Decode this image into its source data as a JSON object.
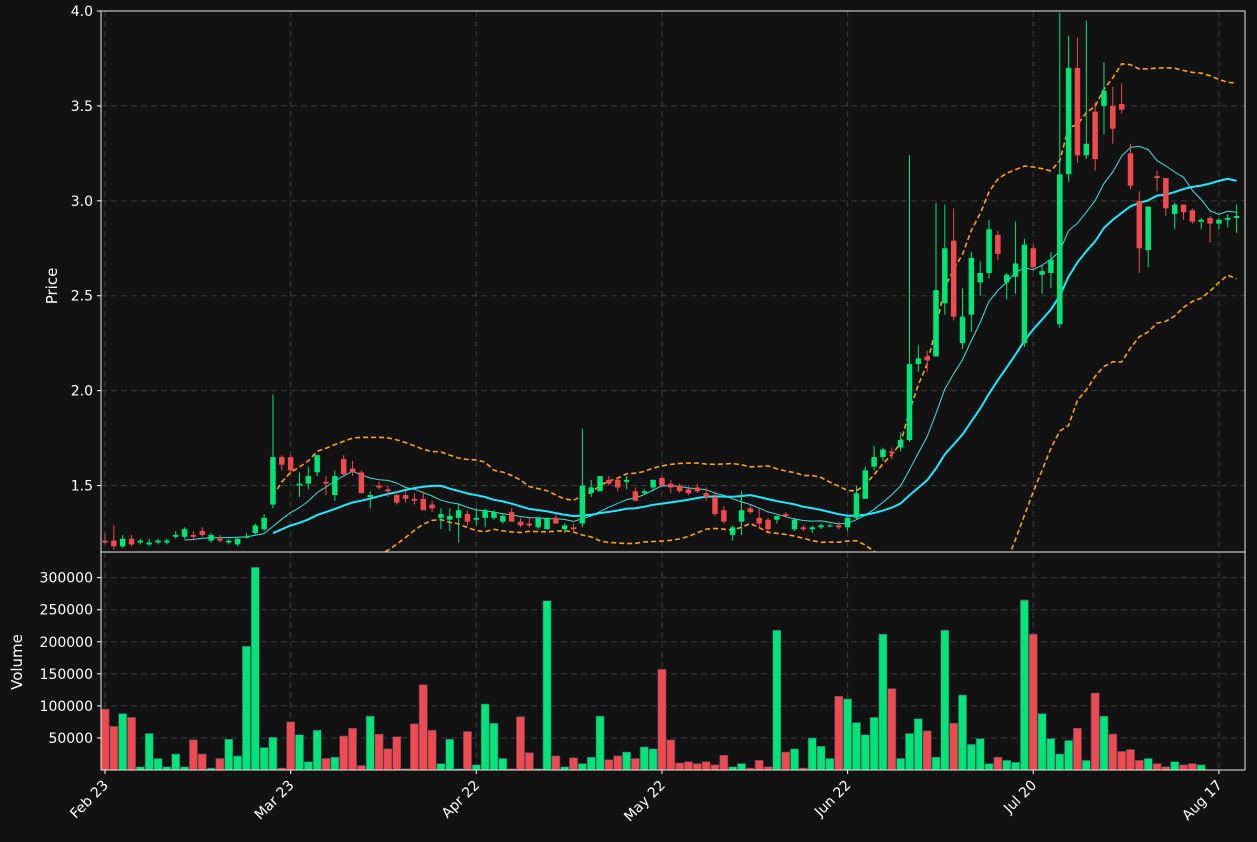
{
  "chart_data": [
    {
      "panel": "price",
      "type": "candlestick",
      "ylabel": "Price",
      "ylim": [
        1.15,
        4.0
      ],
      "yticks": [
        1.5,
        2.0,
        2.5,
        3.0,
        3.5,
        4.0
      ],
      "ytick_labels": [
        "1.5",
        "2.0",
        "2.5",
        "3.0",
        "3.5",
        "4.0"
      ],
      "grid": true,
      "x_labels": [
        "Feb 23",
        "Mar 23",
        "Apr 22",
        "May 22",
        "Jun 22",
        "Jul 20",
        "Aug 17"
      ],
      "x_label_positions": [
        0,
        21,
        42,
        63,
        84,
        105,
        126
      ],
      "colors": {
        "up": "#00e676",
        "down": "#f04a4f",
        "ma_fast": "#3de0e0",
        "ma_slow": "#1de9ff",
        "bands": "#ff9f1a",
        "background": "#121212",
        "grid": "#3a3a3a"
      },
      "ohlc": [
        [
          1.21,
          1.25,
          1.19,
          1.2
        ],
        [
          1.21,
          1.29,
          1.16,
          1.18
        ],
        [
          1.18,
          1.24,
          1.17,
          1.22
        ],
        [
          1.22,
          1.24,
          1.18,
          1.19
        ],
        [
          1.2,
          1.22,
          1.19,
          1.21
        ],
        [
          1.19,
          1.22,
          1.18,
          1.2
        ],
        [
          1.2,
          1.22,
          1.19,
          1.21
        ],
        [
          1.2,
          1.22,
          1.19,
          1.21
        ],
        [
          1.23,
          1.26,
          1.22,
          1.24
        ],
        [
          1.23,
          1.28,
          1.22,
          1.27
        ],
        [
          1.24,
          1.26,
          1.21,
          1.23
        ],
        [
          1.26,
          1.28,
          1.23,
          1.24
        ],
        [
          1.21,
          1.25,
          1.2,
          1.24
        ],
        [
          1.22,
          1.24,
          1.2,
          1.21
        ],
        [
          1.2,
          1.22,
          1.19,
          1.21
        ],
        [
          1.19,
          1.23,
          1.18,
          1.22
        ],
        [
          1.23,
          1.25,
          1.22,
          1.23
        ],
        [
          1.25,
          1.3,
          1.24,
          1.29
        ],
        [
          1.27,
          1.35,
          1.26,
          1.33
        ],
        [
          1.4,
          1.98,
          1.38,
          1.65
        ],
        [
          1.65,
          1.66,
          1.58,
          1.61
        ],
        [
          1.65,
          1.66,
          1.56,
          1.58
        ],
        [
          1.5,
          1.57,
          1.44,
          1.51
        ],
        [
          1.51,
          1.6,
          1.48,
          1.55
        ],
        [
          1.57,
          1.66,
          1.55,
          1.66
        ],
        [
          1.52,
          1.55,
          1.45,
          1.51
        ],
        [
          1.45,
          1.58,
          1.42,
          1.55
        ],
        [
          1.64,
          1.66,
          1.55,
          1.56
        ],
        [
          1.59,
          1.63,
          1.55,
          1.57
        ],
        [
          1.57,
          1.58,
          1.46,
          1.46
        ],
        [
          1.44,
          1.47,
          1.38,
          1.45
        ],
        [
          1.5,
          1.52,
          1.48,
          1.49
        ],
        [
          1.48,
          1.5,
          1.44,
          1.47
        ],
        [
          1.45,
          1.47,
          1.4,
          1.41
        ],
        [
          1.45,
          1.47,
          1.41,
          1.43
        ],
        [
          1.43,
          1.46,
          1.4,
          1.42
        ],
        [
          1.43,
          1.47,
          1.38,
          1.37
        ],
        [
          1.4,
          1.42,
          1.36,
          1.38
        ],
        [
          1.33,
          1.38,
          1.27,
          1.35
        ],
        [
          1.32,
          1.38,
          1.26,
          1.34
        ],
        [
          1.33,
          1.4,
          1.2,
          1.37
        ],
        [
          1.35,
          1.37,
          1.29,
          1.31
        ],
        [
          1.32,
          1.38,
          1.29,
          1.33
        ],
        [
          1.33,
          1.38,
          1.28,
          1.37
        ],
        [
          1.33,
          1.37,
          1.32,
          1.36
        ],
        [
          1.31,
          1.35,
          1.3,
          1.34
        ],
        [
          1.36,
          1.38,
          1.31,
          1.31
        ],
        [
          1.31,
          1.33,
          1.28,
          1.29
        ],
        [
          1.3,
          1.33,
          1.28,
          1.29
        ],
        [
          1.28,
          1.33,
          1.27,
          1.33
        ],
        [
          1.27,
          1.33,
          1.27,
          1.33
        ],
        [
          1.33,
          1.35,
          1.3,
          1.3
        ],
        [
          1.27,
          1.3,
          1.25,
          1.29
        ],
        [
          1.28,
          1.3,
          1.26,
          1.27
        ],
        [
          1.3,
          1.8,
          1.28,
          1.5
        ],
        [
          1.46,
          1.53,
          1.44,
          1.49
        ],
        [
          1.47,
          1.55,
          1.47,
          1.55
        ],
        [
          1.53,
          1.55,
          1.5,
          1.51
        ],
        [
          1.53,
          1.54,
          1.47,
          1.49
        ],
        [
          1.52,
          1.55,
          1.48,
          1.53
        ],
        [
          1.47,
          1.49,
          1.42,
          1.42
        ],
        [
          1.46,
          1.48,
          1.45,
          1.47
        ],
        [
          1.49,
          1.53,
          1.47,
          1.53
        ],
        [
          1.54,
          1.55,
          1.49,
          1.5
        ],
        [
          1.51,
          1.53,
          1.46,
          1.49
        ],
        [
          1.5,
          1.51,
          1.46,
          1.47
        ],
        [
          1.48,
          1.5,
          1.45,
          1.46
        ],
        [
          1.49,
          1.51,
          1.46,
          1.47
        ],
        [
          1.46,
          1.49,
          1.42,
          1.44
        ],
        [
          1.44,
          1.47,
          1.34,
          1.35
        ],
        [
          1.37,
          1.39,
          1.3,
          1.31
        ],
        [
          1.24,
          1.29,
          1.21,
          1.28
        ],
        [
          1.31,
          1.47,
          1.24,
          1.37
        ],
        [
          1.38,
          1.4,
          1.35,
          1.36
        ],
        [
          1.33,
          1.38,
          1.28,
          1.3
        ],
        [
          1.32,
          1.33,
          1.26,
          1.27
        ],
        [
          1.32,
          1.34,
          1.3,
          1.34
        ],
        [
          1.35,
          1.36,
          1.33,
          1.34
        ],
        [
          1.27,
          1.33,
          1.26,
          1.32
        ],
        [
          1.28,
          1.29,
          1.26,
          1.27
        ],
        [
          1.27,
          1.29,
          1.25,
          1.28
        ],
        [
          1.28,
          1.3,
          1.27,
          1.29
        ],
        [
          1.29,
          1.3,
          1.28,
          1.29
        ],
        [
          1.29,
          1.31,
          1.27,
          1.28
        ],
        [
          1.28,
          1.34,
          1.26,
          1.33
        ],
        [
          1.33,
          1.5,
          1.32,
          1.46
        ],
        [
          1.43,
          1.6,
          1.43,
          1.58
        ],
        [
          1.6,
          1.71,
          1.58,
          1.65
        ],
        [
          1.65,
          1.7,
          1.63,
          1.69
        ],
        [
          1.68,
          1.7,
          1.64,
          1.67
        ],
        [
          1.7,
          1.78,
          1.68,
          1.74
        ],
        [
          1.74,
          3.24,
          1.73,
          2.14
        ],
        [
          2.14,
          2.24,
          2.1,
          2.17
        ],
        [
          2.18,
          2.21,
          2.1,
          2.16
        ],
        [
          2.18,
          2.99,
          2.18,
          2.53
        ],
        [
          2.46,
          2.98,
          2.4,
          2.75
        ],
        [
          2.79,
          2.96,
          2.37,
          2.39
        ],
        [
          2.25,
          2.54,
          2.22,
          2.39
        ],
        [
          2.4,
          2.73,
          2.31,
          2.7
        ],
        [
          2.57,
          2.68,
          2.5,
          2.62
        ],
        [
          2.62,
          2.9,
          2.59,
          2.85
        ],
        [
          2.82,
          2.84,
          2.69,
          2.72
        ],
        [
          2.57,
          2.62,
          2.48,
          2.61
        ],
        [
          2.6,
          2.89,
          2.51,
          2.67
        ],
        [
          2.25,
          2.8,
          2.23,
          2.77
        ],
        [
          2.75,
          2.77,
          2.63,
          2.65
        ],
        [
          2.61,
          2.66,
          2.51,
          2.63
        ],
        [
          2.62,
          2.73,
          2.54,
          2.69
        ],
        [
          2.35,
          3.99,
          2.33,
          3.14
        ],
        [
          3.14,
          3.87,
          3.1,
          3.7
        ],
        [
          3.7,
          3.86,
          3.2,
          3.24
        ],
        [
          3.24,
          3.95,
          3.22,
          3.3
        ],
        [
          3.47,
          3.52,
          3.16,
          3.22
        ],
        [
          3.5,
          3.73,
          3.35,
          3.58
        ],
        [
          3.5,
          3.6,
          3.3,
          3.38
        ],
        [
          3.51,
          3.62,
          3.46,
          3.48
        ],
        [
          3.25,
          3.3,
          3.06,
          3.08
        ],
        [
          3.0,
          3.05,
          2.62,
          2.75
        ],
        [
          2.74,
          2.97,
          2.65,
          2.97
        ],
        [
          3.13,
          3.16,
          3.05,
          3.12
        ],
        [
          3.12,
          3.12,
          2.92,
          2.96
        ],
        [
          2.93,
          2.99,
          2.85,
          2.98
        ],
        [
          2.98,
          2.98,
          2.9,
          2.94
        ],
        [
          2.95,
          2.96,
          2.88,
          2.89
        ],
        [
          2.89,
          2.91,
          2.85,
          2.9
        ],
        [
          2.91,
          2.92,
          2.78,
          2.88
        ],
        [
          2.88,
          2.91,
          2.85,
          2.9
        ],
        [
          2.9,
          2.93,
          2.86,
          2.91
        ],
        [
          2.91,
          2.98,
          2.83,
          2.92
        ]
      ]
    },
    {
      "panel": "volume",
      "type": "bar",
      "ylabel": "Volume",
      "ylim": [
        0,
        340000
      ],
      "yticks": [
        50000,
        100000,
        150000,
        200000,
        250000,
        300000
      ],
      "ytick_labels": [
        "50000",
        "100000",
        "150000",
        "200000",
        "250000",
        "300000"
      ],
      "grid": true,
      "values": [
        95000,
        68000,
        88000,
        82000,
        5000,
        57000,
        18000,
        5000,
        25000,
        5000,
        47000,
        25000,
        3000,
        18000,
        48000,
        22000,
        193000,
        316000,
        35000,
        51000,
        3000,
        75000,
        55000,
        13000,
        62000,
        18000,
        20000,
        53000,
        65000,
        7000,
        84000,
        56000,
        33000,
        52000,
        2000,
        72000,
        133000,
        62000,
        10000,
        48000,
        2000,
        60000,
        8000,
        103000,
        73000,
        18000,
        2000,
        83000,
        27000,
        2000,
        264000,
        22000,
        5000,
        19000,
        10000,
        20000,
        84000,
        16000,
        22000,
        28000,
        18000,
        36000,
        33000,
        157000,
        47000,
        11000,
        13000,
        10000,
        13000,
        8000,
        23000,
        5000,
        10000,
        3000,
        15000,
        5000,
        218000,
        28000,
        33000,
        3000,
        50000,
        37000,
        18000,
        115000,
        111000,
        74000,
        55000,
        82000,
        212000,
        127000,
        18000,
        57000,
        80000,
        61000,
        20000,
        218000,
        73000,
        117000,
        40000,
        49000,
        10000,
        20000,
        15000,
        12000,
        265000,
        212000,
        88000,
        49000,
        25000,
        46000,
        65000,
        15000,
        120000,
        84000,
        56000,
        29000,
        32000,
        15000,
        18000,
        10000,
        5000,
        13000,
        8000,
        10000,
        8000
      ]
    }
  ]
}
